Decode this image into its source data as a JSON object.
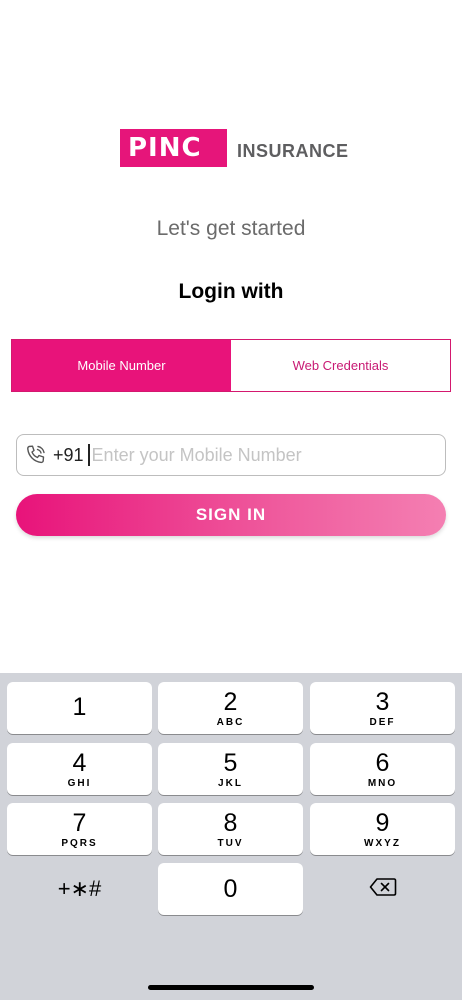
{
  "brand": {
    "logo_text": "PINC",
    "logo_suffix": "INSURANCE",
    "accent": "#e6157a"
  },
  "header": {
    "subtitle": "Let's get started",
    "login_with": "Login with"
  },
  "tabs": [
    {
      "label": "Mobile Number",
      "active": true
    },
    {
      "label": "Web Credentials",
      "active": false
    }
  ],
  "phone": {
    "icon": "phone-icon",
    "prefix": "+91",
    "value": "",
    "placeholder": "Enter your Mobile Number"
  },
  "signin": {
    "label": "SIGN IN"
  },
  "keypad": {
    "keys": [
      {
        "num": "1",
        "letters": ""
      },
      {
        "num": "2",
        "letters": "ABC"
      },
      {
        "num": "3",
        "letters": "DEF"
      },
      {
        "num": "4",
        "letters": "GHI"
      },
      {
        "num": "5",
        "letters": "JKL"
      },
      {
        "num": "6",
        "letters": "MNO"
      },
      {
        "num": "7",
        "letters": "PQRS"
      },
      {
        "num": "8",
        "letters": "TUV"
      },
      {
        "num": "9",
        "letters": "WXYZ"
      },
      {
        "num": "0",
        "letters": ""
      }
    ],
    "symbols_label": "+∗#",
    "delete_icon": "backspace-icon"
  }
}
